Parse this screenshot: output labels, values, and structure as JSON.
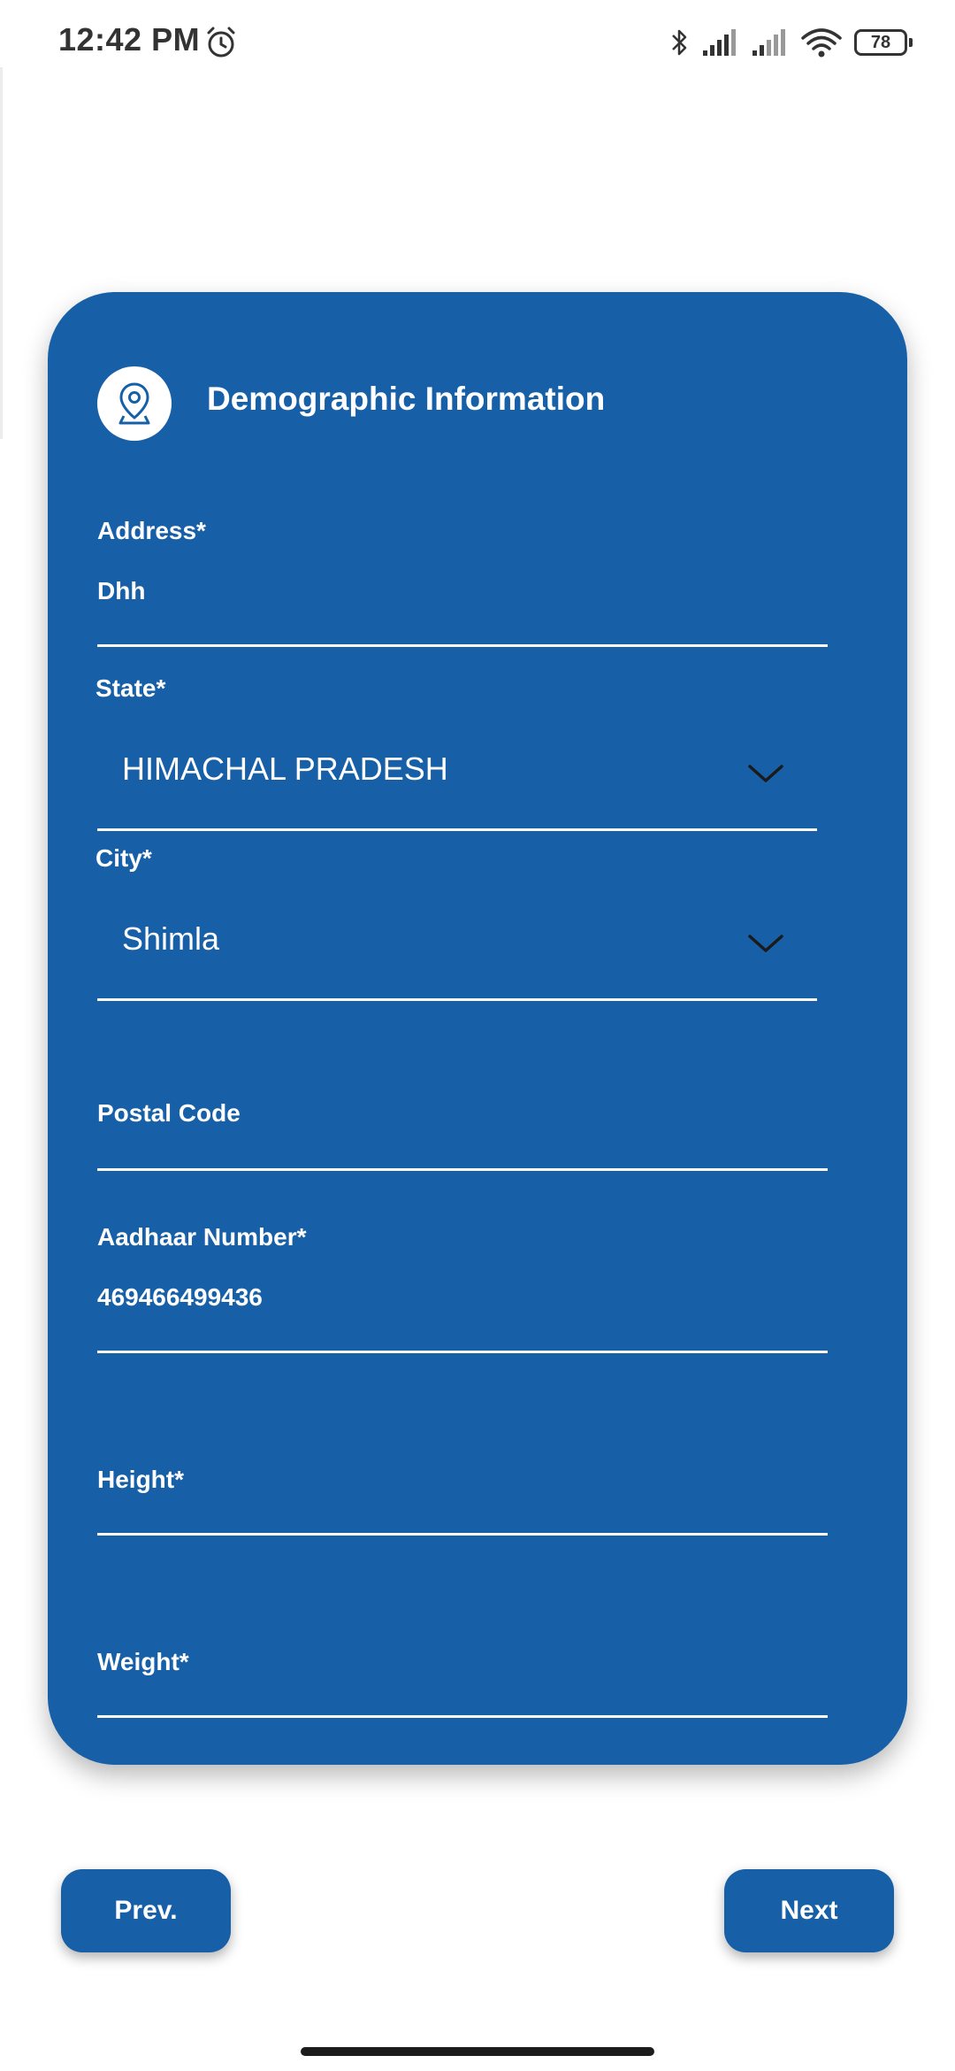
{
  "status_bar": {
    "time": "12:42 PM",
    "battery": "78",
    "icons": [
      "alarm-icon",
      "bluetooth-icon",
      "signal-icon",
      "signal-icon",
      "wifi-icon",
      "battery-icon"
    ]
  },
  "colors": {
    "card": "#1760a8",
    "text_on_card": "#ffffff",
    "background": "#ffffff"
  },
  "form": {
    "icon": "location-pin-icon",
    "title": "Demographic Information",
    "address": {
      "label": "Address*",
      "value": "Dhh"
    },
    "state": {
      "label": "State*",
      "value": "HIMACHAL PRADESH"
    },
    "city": {
      "label": "City*",
      "value": "Shimla"
    },
    "postal_code": {
      "label": "Postal Code",
      "value": ""
    },
    "aadhaar": {
      "label": "Aadhaar Number*",
      "value": "469466499436"
    },
    "height": {
      "label": "Height*",
      "value": ""
    },
    "weight": {
      "label": "Weight*",
      "value": ""
    }
  },
  "buttons": {
    "prev": "Prev.",
    "next": "Next"
  }
}
